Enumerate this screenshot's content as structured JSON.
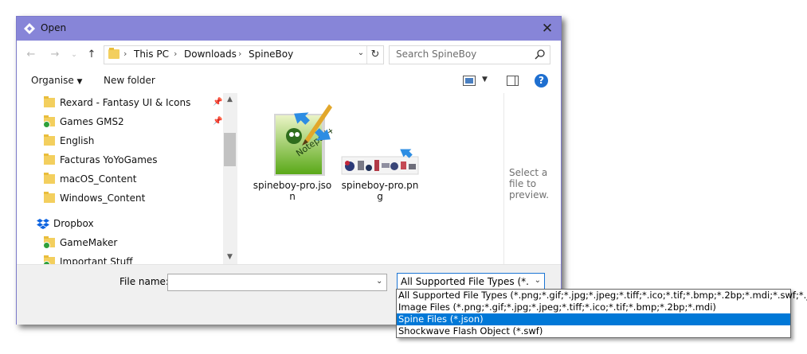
{
  "window": {
    "title": "Open"
  },
  "nav": {
    "breadcrumbs": [
      "This PC",
      "Downloads",
      "SpineBoy"
    ],
    "search_placeholder": "Search SpineBoy"
  },
  "toolbar": {
    "organise_label": "Organise",
    "new_folder_label": "New folder"
  },
  "sidebar": {
    "items": [
      {
        "label": "Rexard - Fantasy UI & Icons",
        "pinned": true
      },
      {
        "label": "Games GMS2",
        "pinned": true
      },
      {
        "label": "English"
      },
      {
        "label": "Facturas YoYoGames"
      },
      {
        "label": "macOS_Content"
      },
      {
        "label": "Windows_Content"
      },
      {
        "label": "Dropbox"
      },
      {
        "label": "GameMaker"
      },
      {
        "label": "Important Stuff"
      }
    ]
  },
  "files": [
    {
      "name": "spineboy-pro.json",
      "icon": "notepad-plus-plus-icon"
    },
    {
      "name": "spineboy-pro.png",
      "icon": "image-thumbnail"
    }
  ],
  "preview": {
    "text": "Select a file to preview."
  },
  "footer": {
    "filename_label": "File name:",
    "filename_value": "",
    "filetype_selected": "All Supported File Types (*.png;",
    "filetype_options": [
      {
        "label": "All Supported File Types (*.png;*.gif;*.jpg;*.jpeg;*.tiff;*.ico;*.tif;*.bmp;*.2bp;*.mdi;*.swf;*.json)"
      },
      {
        "label": "Image Files (*.png;*.gif;*.jpg;*.jpeg;*.tiff;*.ico;*.tif;*.bmp;*.2bp;*.mdi)"
      },
      {
        "label": "Spine Files (*.json)",
        "highlighted": true
      },
      {
        "label": "Shockwave Flash Object (*.swf)"
      }
    ]
  },
  "colors": {
    "titlebar": "#8785d8",
    "highlight": "#0078d7",
    "help": "#1e6fd0"
  }
}
